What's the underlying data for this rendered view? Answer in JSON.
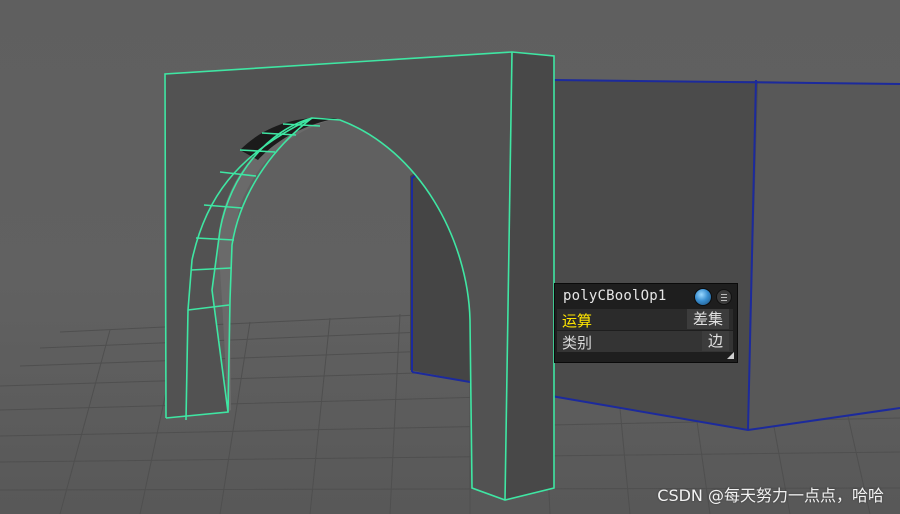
{
  "hud": {
    "node_name": "polyCBoolOp1",
    "rows": [
      {
        "label": "运算",
        "value": "差集"
      },
      {
        "label": "类别",
        "value": "边"
      }
    ],
    "icons": [
      "sphere-icon",
      "menu-icon"
    ]
  },
  "watermark": "CSDN @每天努力一点点，哈哈",
  "colors": {
    "selected_wireframe": "#3fe6a3",
    "box_wireframe": "#1c2a9c",
    "active_label": "#ffe600"
  }
}
